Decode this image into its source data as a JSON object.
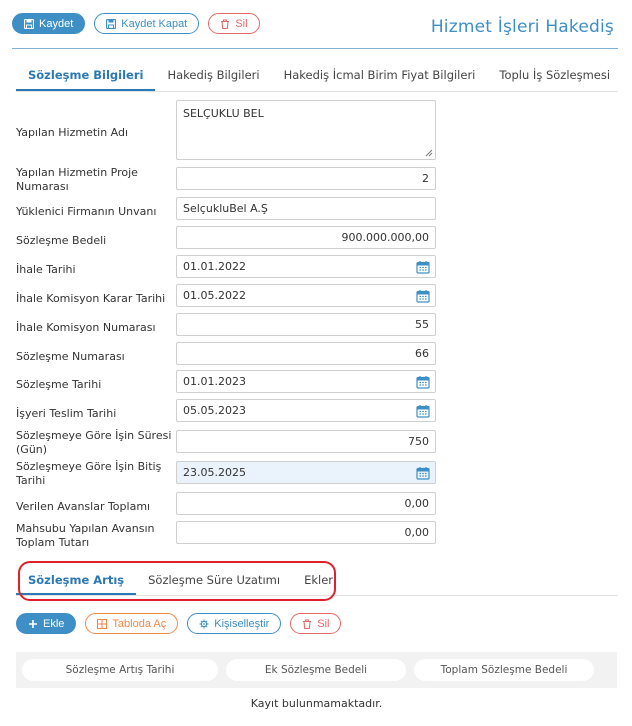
{
  "toolbar": {
    "save": "Kaydet",
    "save_close": "Kaydet Kapat",
    "delete": "Sil"
  },
  "page_title": "Hizmet İşleri Hakediş",
  "tabs": [
    {
      "label": "Sözleşme Bilgileri",
      "active": true
    },
    {
      "label": "Hakediş Bilgileri",
      "active": false
    },
    {
      "label": "Hakediş İcmal Birim Fiyat Bilgileri",
      "active": false
    },
    {
      "label": "Toplu İş Sözleşmesi",
      "active": false
    }
  ],
  "form": {
    "service_name": {
      "label": "Yapılan Hizmetin Adı",
      "value": "SELÇUKLU BEL"
    },
    "project_no": {
      "label": "Yapılan Hizmetin Proje Numarası",
      "value": "2"
    },
    "contractor": {
      "label": "Yüklenici Firmanın Unvanı",
      "value": "SelçukluBel A.Ş"
    },
    "contract_amount": {
      "label": "Sözleşme Bedeli",
      "value": "900.000.000,00"
    },
    "tender_date": {
      "label": "İhale Tarihi",
      "value": "01.01.2022"
    },
    "commission_decision_date": {
      "label": "İhale Komisyon Karar Tarihi",
      "value": "01.05.2022"
    },
    "commission_no": {
      "label": "İhale Komisyon Numarası",
      "value": "55"
    },
    "contract_no": {
      "label": "Sözleşme Numarası",
      "value": "66"
    },
    "contract_date": {
      "label": "Sözleşme Tarihi",
      "value": "01.01.2023"
    },
    "site_delivery_date": {
      "label": "İşyeri Teslim Tarihi",
      "value": "05.05.2023"
    },
    "duration_days": {
      "label": "Sözleşmeye Göre İşin Süresi (Gün)",
      "value": "750"
    },
    "end_date": {
      "label": "Sözleşmeye Göre İşin Bitiş Tarihi",
      "value": "23.05.2025"
    },
    "advances_total": {
      "label": "Verilen Avanslar Toplamı",
      "value": "0,00"
    },
    "offset_advance_total": {
      "label": "Mahsubu Yapılan Avansın Toplam Tutarı",
      "value": "0,00"
    }
  },
  "subtabs": [
    {
      "label": "Sözleşme Artış",
      "active": true
    },
    {
      "label": "Sözleşme Süre Uzatımı",
      "active": false
    },
    {
      "label": "Ekler",
      "active": false
    }
  ],
  "toolbar2": {
    "add": "Ekle",
    "open_table": "Tabloda Aç",
    "customize": "Kişiselleştir",
    "delete": "Sil"
  },
  "table": {
    "columns": [
      "Sözleşme Artış Tarihi",
      "Ek Sözleşme Bedeli",
      "Toplam Sözleşme Bedeli"
    ],
    "empty_text": "Kayıt bulunmamaktadır."
  },
  "colors": {
    "primary": "#3d8fc6",
    "danger": "#e36a6a",
    "warning": "#f08a4b",
    "annotation": "#e0202a"
  }
}
